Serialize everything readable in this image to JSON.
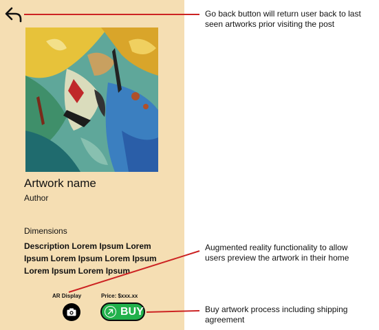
{
  "screen": {
    "artwork_title": "Artwork name",
    "author": "Author",
    "dimensions_label": "Dimensions",
    "description": "Description Lorem Ipsum Lorem Ipsum Lorem Ipsum Lorem Ipsum Lorem Ipsum Lorem Ipsum",
    "ar_label": "AR Display",
    "price_label": "Price: $xxx.xx",
    "buy_label": "BUY",
    "icons": {
      "back": "back-arrow-icon",
      "ar": "camera-icon",
      "buy": "arrow-up-right-circle-icon"
    }
  },
  "annotations": {
    "back": "Go back button will return user back to last seen artworks prior visiting the post",
    "ar": "Augmented reality functionality to allow users preview the artwork in their home",
    "buy": "Buy artwork process including shipping agreement"
  },
  "colors": {
    "panel_background": "#f5deb3",
    "buy_button": "#22b14c",
    "annotation_line": "#cc2222"
  }
}
